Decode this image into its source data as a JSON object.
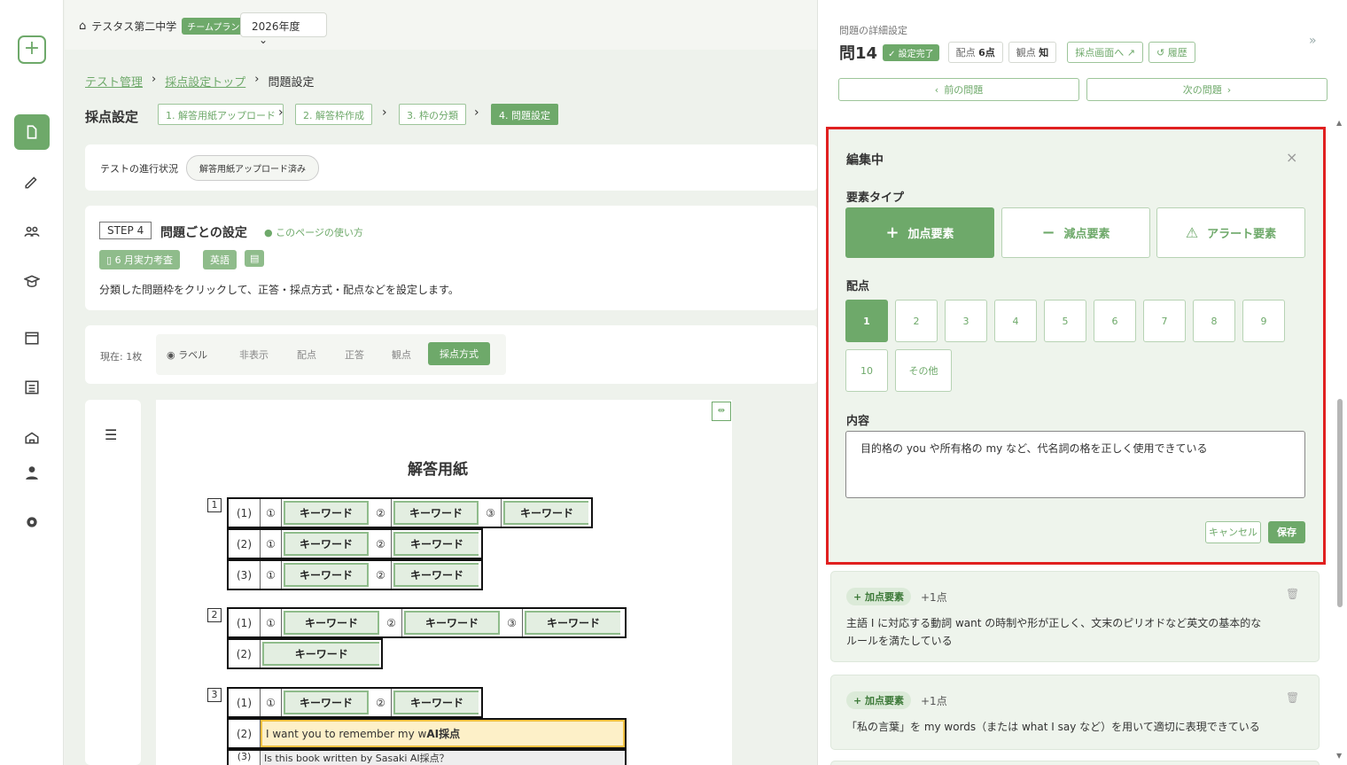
{
  "app": {
    "school": "テスタス第二中学",
    "plan": "チームプラン",
    "year": "2026年度"
  },
  "breadcrumb": [
    "テスト管理",
    "採点設定トップ",
    "問題設定"
  ],
  "page_title": "採点設定",
  "steps": [
    "1. 解答用紙アップロード",
    "2. 解答枠作成",
    "3. 枠の分類",
    "4. 問題設定"
  ],
  "progress": {
    "label": "テストの進行状況",
    "status": "解答用紙アップロード済み"
  },
  "step_card": {
    "step": "STEP 4",
    "title": "問題ごとの設定",
    "help": "このページの使い方",
    "exam": "6 月実力考査",
    "subject": "英語",
    "desc": "分類した問題枠をクリックして、正答・採点方式・配点などを設定します。"
  },
  "toolbar": {
    "current": "現在: 1枚",
    "items": [
      "ラベル",
      "非表示",
      "配点",
      "正答",
      "観点",
      "採点方式"
    ]
  },
  "sheet": {
    "title": "解答用紙",
    "kw": "キーワード",
    "q1": "1",
    "q2": "2",
    "q3": "3",
    "r1": "(1)",
    "r2": "(2)",
    "r3": "(3)",
    "c1": "①",
    "c2": "②",
    "c3": "③",
    "answer_text": "I want you to remember my w",
    "ai_label": "AI採点",
    "partial": "Is this book written by Sasaki AI採点？"
  },
  "panel": {
    "header": "問題の詳細設定",
    "qnum": "問14",
    "status": "設定完了",
    "points_label": "配点",
    "points_value": "6点",
    "view_label": "観点",
    "view_value": "知",
    "grade_screen": "採点画面へ",
    "history": "履歴",
    "prev": "前の問題",
    "next": "次の問題"
  },
  "editor": {
    "title": "編集中",
    "type_label": "要素タイプ",
    "types": [
      "加点要素",
      "減点要素",
      "アラート要素"
    ],
    "points_label": "配点",
    "points": [
      "1",
      "2",
      "3",
      "4",
      "5",
      "6",
      "7",
      "8",
      "9",
      "10",
      "その他"
    ],
    "content_label": "内容",
    "content": "目的格の you や所有格の my など、代名詞の格を正しく使用できている",
    "cancel": "キャンセル",
    "save": "保存"
  },
  "elements": [
    {
      "badge": "+ 加点要素",
      "points": "+1点",
      "text": "主語 I に対応する動詞 want の時制や形が正しく、文末のピリオドなど英文の基本的なルールを満たしている"
    },
    {
      "badge": "+ 加点要素",
      "points": "+1点",
      "text": "「私の言葉」を my words（または what I say など）を用いて適切に表現できている"
    }
  ],
  "colors": {
    "accent": "#6ea96a",
    "highlight": "#e02020"
  }
}
